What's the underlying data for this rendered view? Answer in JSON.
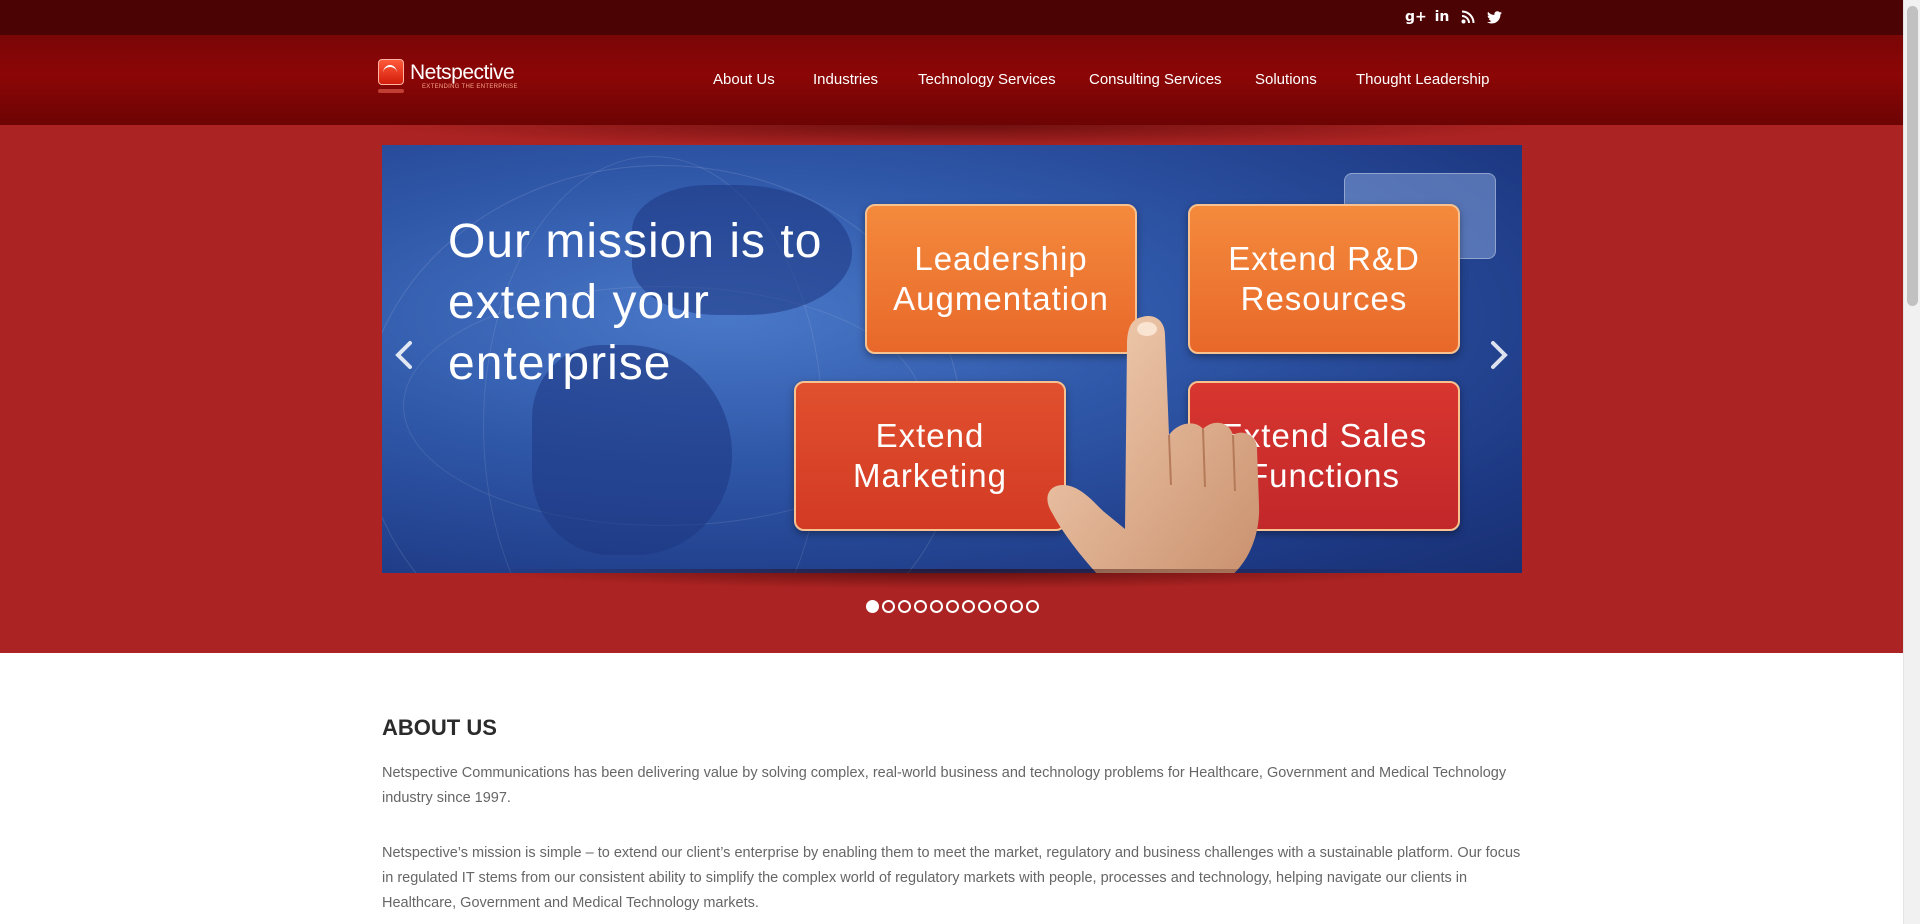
{
  "colors": {
    "topbar": "#4c0303",
    "navbar": "#7a0606",
    "hero": "#ab2322",
    "tile_orange": "#e8682a",
    "tile_red": "#d33a24"
  },
  "social": [
    {
      "icon": "google-plus-icon",
      "glyph": "g+"
    },
    {
      "icon": "linkedin-icon",
      "glyph": "in"
    },
    {
      "icon": "rss-icon",
      "glyph": ""
    },
    {
      "icon": "twitter-icon",
      "glyph": ""
    }
  ],
  "logo": {
    "name": "Netspective",
    "tagline": "EXTENDING THE ENTERPRISE"
  },
  "nav": {
    "items": [
      "About Us",
      "Industries",
      "Technology Services",
      "Consulting Services",
      "Solutions",
      "Thought Leadership"
    ]
  },
  "slider": {
    "mission": "Our mission is to extend your enterprise",
    "tiles": [
      "Leadership Augmentation",
      "Extend R&D Resources",
      "Extend Marketing",
      "Extend Sales Functions"
    ],
    "slide_count": 11,
    "active_index": 0
  },
  "about": {
    "title": "ABOUT US",
    "paragraph1": "Netspective Communications has been delivering value by solving complex, real-world business and technology problems for Healthcare, Government and Medical Technology industry since 1997.",
    "paragraph2": "Netspective’s mission is simple – to extend our client’s enterprise by enabling them to meet the market, regulatory and business challenges with a sustainable platform. Our focus in regulated IT stems from our consistent ability to simplify the complex world of regulatory markets with people, processes and technology, helping navigate our clients in Healthcare, Government and Medical Technology markets."
  }
}
